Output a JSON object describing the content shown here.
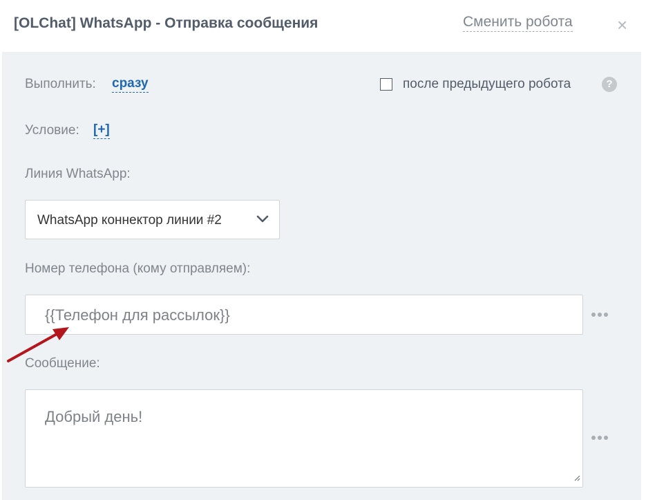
{
  "header": {
    "title": "[OLChat] WhatsApp - Отправка сообщения",
    "change_robot_label": "Сменить робота",
    "close_symbol": "×"
  },
  "execute": {
    "label": "Выполнить:",
    "value": "сразу",
    "after_previous_label": "после предыдущего робота",
    "after_previous_checked": false,
    "help_symbol": "?"
  },
  "condition": {
    "label": "Условие:",
    "add_label": "[+]"
  },
  "line": {
    "label": "Линия WhatsApp:",
    "selected": "WhatsApp коннектор линии #2"
  },
  "phone": {
    "label": "Номер телефона (кому отправляем):",
    "value": "{{Телефон для рассылок}}"
  },
  "message": {
    "label": "Сообщение:",
    "value": "Добрый день!"
  },
  "colors": {
    "accent_link": "#2067b0",
    "panel_bg": "#eef2f4",
    "annotation_arrow": "#b3161d"
  },
  "icons": [
    "close-icon",
    "help-icon",
    "chevron-down-icon",
    "more-dots-icon",
    "resize-handle-icon",
    "annotation-arrow"
  ]
}
